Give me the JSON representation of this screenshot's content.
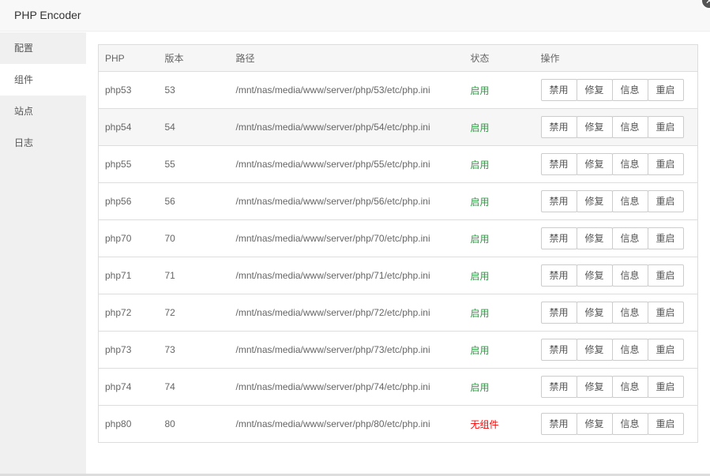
{
  "window": {
    "title": "PHP Encoder",
    "close": "✕"
  },
  "sidebar": {
    "items": [
      {
        "label": "配置"
      },
      {
        "label": "组件"
      },
      {
        "label": "站点"
      },
      {
        "label": "日志"
      }
    ],
    "active_index": 1
  },
  "table": {
    "headers": [
      "PHP",
      "版本",
      "路径",
      "状态",
      "操作"
    ],
    "actions": [
      "禁用",
      "修复",
      "信息",
      "重启"
    ],
    "rows": [
      {
        "php": "php53",
        "version": "53",
        "path": "/mnt/nas/media/www/server/php/53/etc/php.ini",
        "status": "启用"
      },
      {
        "php": "php54",
        "version": "54",
        "path": "/mnt/nas/media/www/server/php/54/etc/php.ini",
        "status": "启用"
      },
      {
        "php": "php55",
        "version": "55",
        "path": "/mnt/nas/media/www/server/php/55/etc/php.ini",
        "status": "启用"
      },
      {
        "php": "php56",
        "version": "56",
        "path": "/mnt/nas/media/www/server/php/56/etc/php.ini",
        "status": "启用"
      },
      {
        "php": "php70",
        "version": "70",
        "path": "/mnt/nas/media/www/server/php/70/etc/php.ini",
        "status": "启用"
      },
      {
        "php": "php71",
        "version": "71",
        "path": "/mnt/nas/media/www/server/php/71/etc/php.ini",
        "status": "启用"
      },
      {
        "php": "php72",
        "version": "72",
        "path": "/mnt/nas/media/www/server/php/72/etc/php.ini",
        "status": "启用"
      },
      {
        "php": "php73",
        "version": "73",
        "path": "/mnt/nas/media/www/server/php/73/etc/php.ini",
        "status": "启用"
      },
      {
        "php": "php74",
        "version": "74",
        "path": "/mnt/nas/media/www/server/php/74/etc/php.ini",
        "status": "启用"
      },
      {
        "php": "php80",
        "version": "80",
        "path": "/mnt/nas/media/www/server/php/80/etc/php.ini",
        "status": "无组件"
      }
    ]
  },
  "colors": {
    "status_enabled": "#20a53a",
    "status_missing": "#ff0000"
  }
}
